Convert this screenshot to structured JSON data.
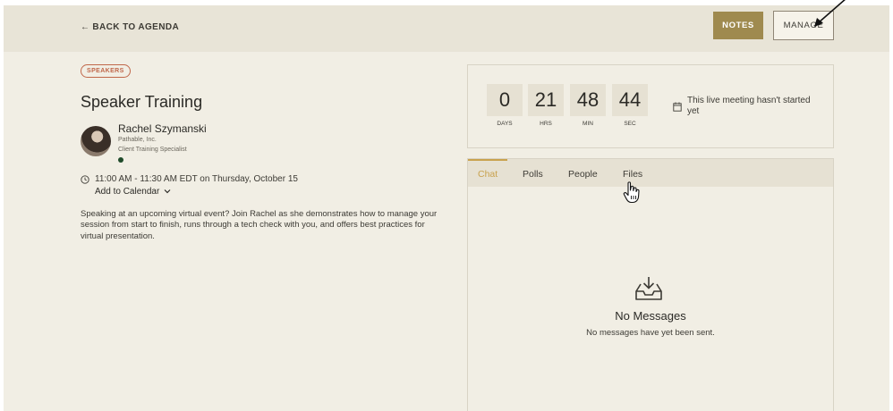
{
  "header": {
    "back_label": "BACK TO AGENDA",
    "notes_label": "NOTES",
    "manage_label": "MANAGE"
  },
  "session": {
    "badge": "SPEAKERS",
    "title": "Speaker Training",
    "speaker": {
      "name": "Rachel Szymanski",
      "company": "Pathable, Inc.",
      "role": "Client Training Specialist"
    },
    "time": "11:00 AM - 11:30 AM EDT on Thursday, October 15",
    "add_to_calendar": "Add to Calendar",
    "description": "Speaking at an upcoming virtual event? Join Rachel as she demonstrates how to manage your session from start to finish, runs through a tech check with you, and offers best practices for virtual presentation."
  },
  "countdown": {
    "units": [
      {
        "value": "0",
        "label": "DAYS"
      },
      {
        "value": "21",
        "label": "HRS"
      },
      {
        "value": "48",
        "label": "MIN"
      },
      {
        "value": "44",
        "label": "SEC"
      }
    ],
    "message": "This live meeting hasn't started yet"
  },
  "panel": {
    "tabs": [
      {
        "label": "Chat",
        "active": true
      },
      {
        "label": "Polls",
        "active": false
      },
      {
        "label": "People",
        "active": false
      },
      {
        "label": "Files",
        "active": false
      }
    ],
    "empty_title": "No Messages",
    "empty_subtitle": "No messages have yet been sent."
  },
  "colors": {
    "accent": "#9f8a4f",
    "tab_active": "#c9a24e",
    "badge": "#c0674a"
  },
  "icons": [
    "back-arrow-icon",
    "clock-icon",
    "chevron-down-icon",
    "calendar-icon",
    "inbox-tray-icon",
    "hand-cursor-icon"
  ]
}
